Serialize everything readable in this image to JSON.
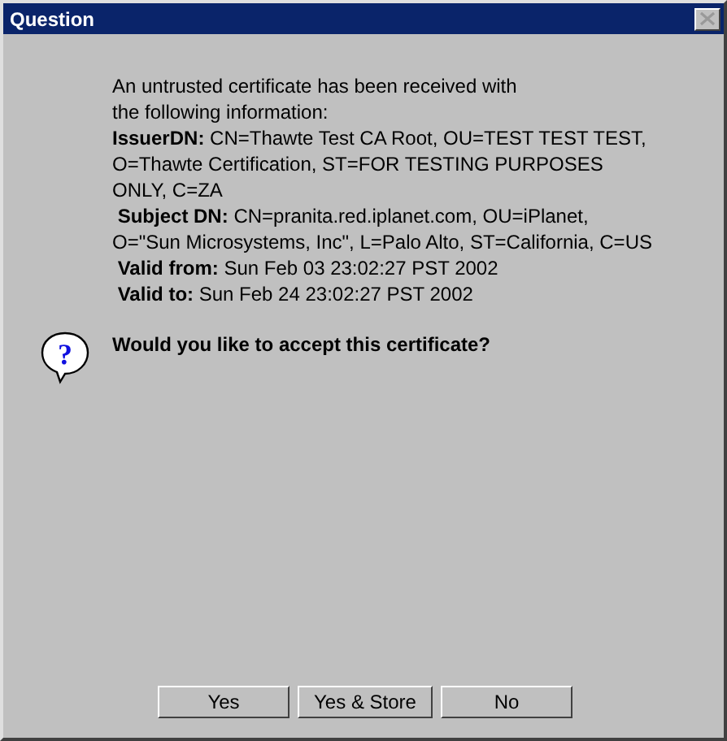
{
  "window": {
    "title": "Question"
  },
  "message_lines": [
    "An untrusted certificate has been received with",
    "the following information:",
    "**IssuerDN:** CN=Thawte Test CA Root, OU=TEST TEST TEST,",
    "O=Thawte Certification, ST=FOR TESTING PURPOSES",
    "ONLY, C=ZA",
    " **Subject DN:** CN=pranita.red.iplanet.com, OU=iPlanet,",
    "O=\"Sun Microsystems, Inc\", L=Palo Alto, ST=California, C=US",
    " **Valid from:** Sun Feb 03 23:02:27 PST 2002",
    " **Valid to:** Sun Feb 24 23:02:27 PST 2002"
  ],
  "question": {
    "icon_glyph": "?",
    "text": "Would you like to accept this certificate?"
  },
  "buttons": [
    "Yes",
    "Yes & Store",
    "No"
  ]
}
